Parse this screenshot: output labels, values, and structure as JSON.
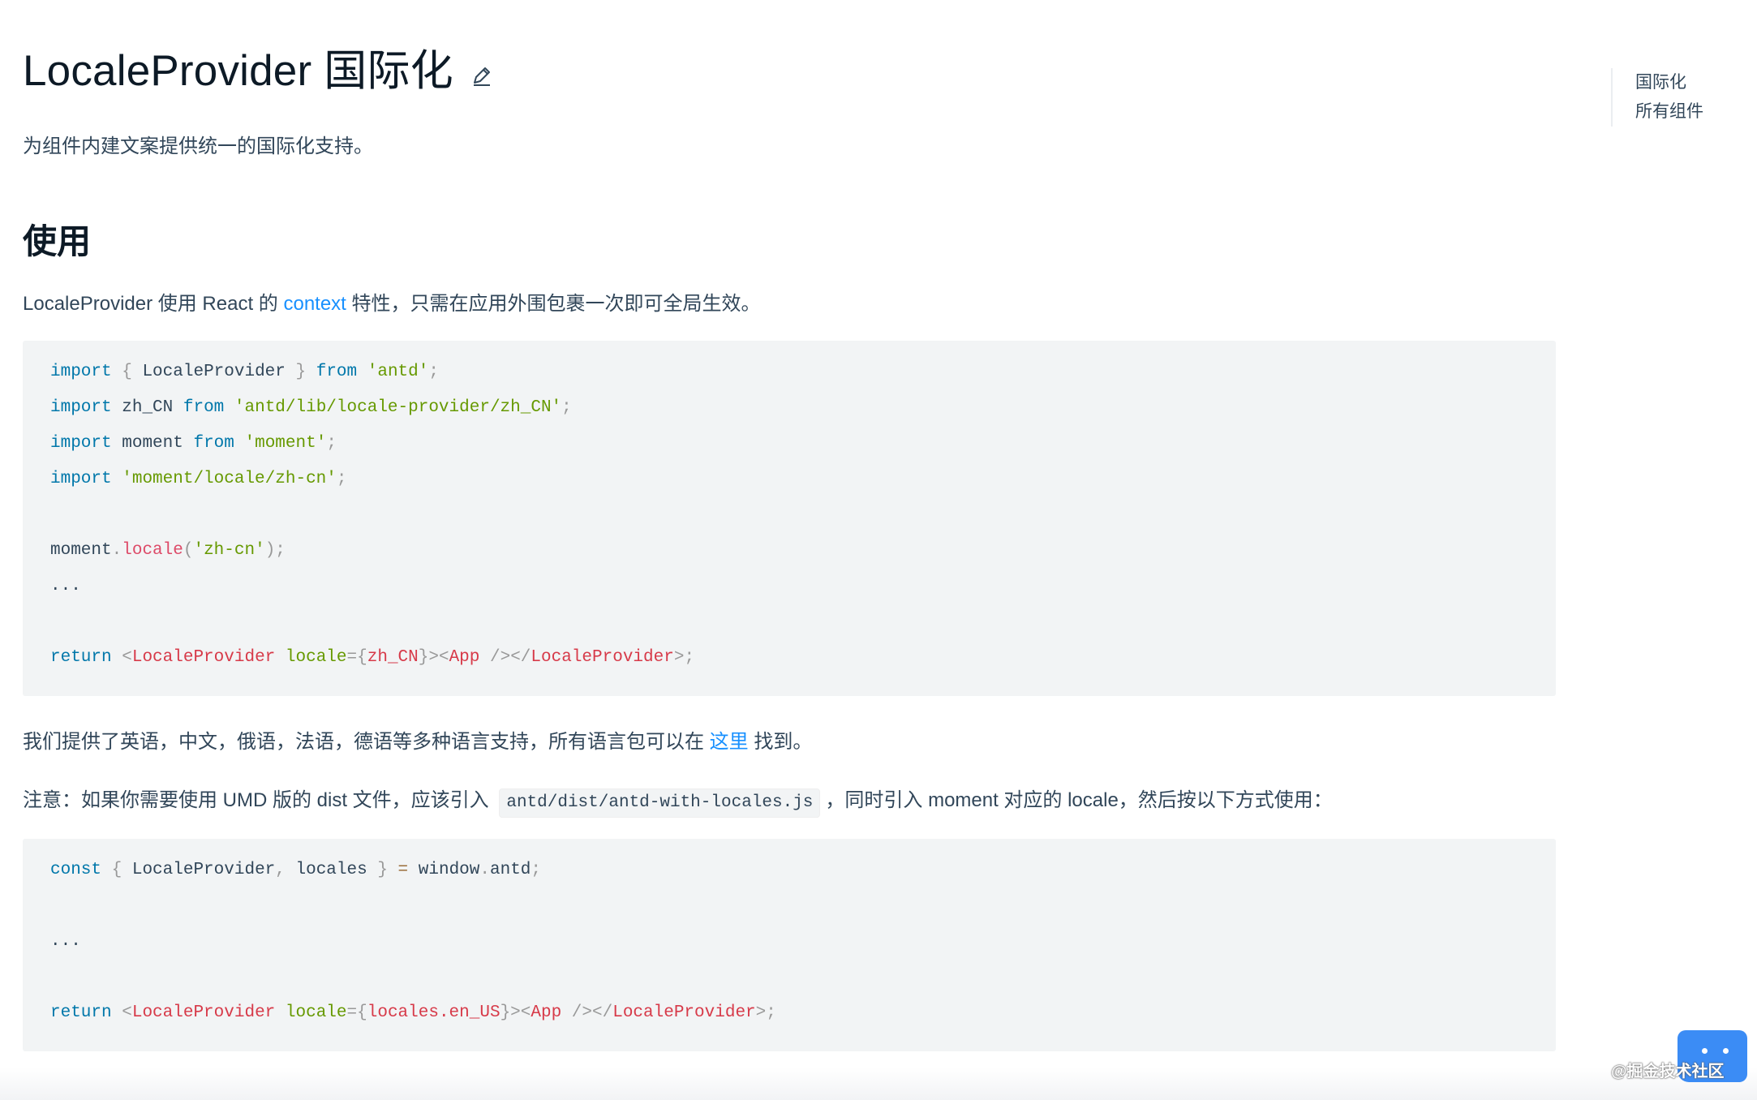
{
  "header": {
    "title": "LocaleProvider 国际化",
    "subtitle": "为组件内建文案提供统一的国际化支持。"
  },
  "toc": {
    "items": [
      "国际化",
      "所有组件"
    ]
  },
  "section": {
    "title": "使用",
    "intro_before": "LocaleProvider 使用 React 的 ",
    "intro_link": "context",
    "intro_after": " 特性，只需在应用外围包裹一次即可全局生效。",
    "langs_before": "我们提供了英语，中文，俄语，法语，德语等多种语言支持，所有语言包可以在 ",
    "langs_link": "这里",
    "langs_after": " 找到。",
    "note_before": "注意：如果你需要使用 UMD 版的 dist 文件，应该引入 ",
    "note_code": "antd/dist/antd-with-locales.js",
    "note_after": "，同时引入 moment 对应的 locale，然后按以下方式使用："
  },
  "code1": {
    "kw_import": "import",
    "kw_from": "from",
    "kw_return": "return",
    "l1_name": "LocaleProvider",
    "l1_src": "'antd'",
    "l2_name": "zh_CN",
    "l2_src": "'antd/lib/locale-provider/zh_CN'",
    "l3_name": "moment",
    "l3_src": "'moment'",
    "l4_src": "'moment/locale/zh-cn'",
    "l5_obj": "moment",
    "l5_fn": "locale",
    "l5_arg": "'zh-cn'",
    "ellipsis": "...",
    "tag_provider": "LocaleProvider",
    "attr_locale": "locale",
    "locale_val": "zh_CN",
    "tag_app": "App"
  },
  "code2": {
    "kw_const": "const",
    "name1": "LocaleProvider",
    "name2": "locales",
    "obj": "window",
    "prop": "antd",
    "ellipsis": "...",
    "kw_return": "return",
    "tag_provider": "LocaleProvider",
    "attr_locale": "locale",
    "locale_val": "locales.en_US",
    "tag_app": "App"
  },
  "watermark": "@掘金技术社区",
  "icons": {
    "edit": "edit-icon",
    "chat": "chat-icon"
  },
  "colors": {
    "link": "#1890ff",
    "code_bg": "#f2f4f5",
    "keyword": "#0077aa",
    "string": "#669900",
    "tag": "#d73a49"
  }
}
